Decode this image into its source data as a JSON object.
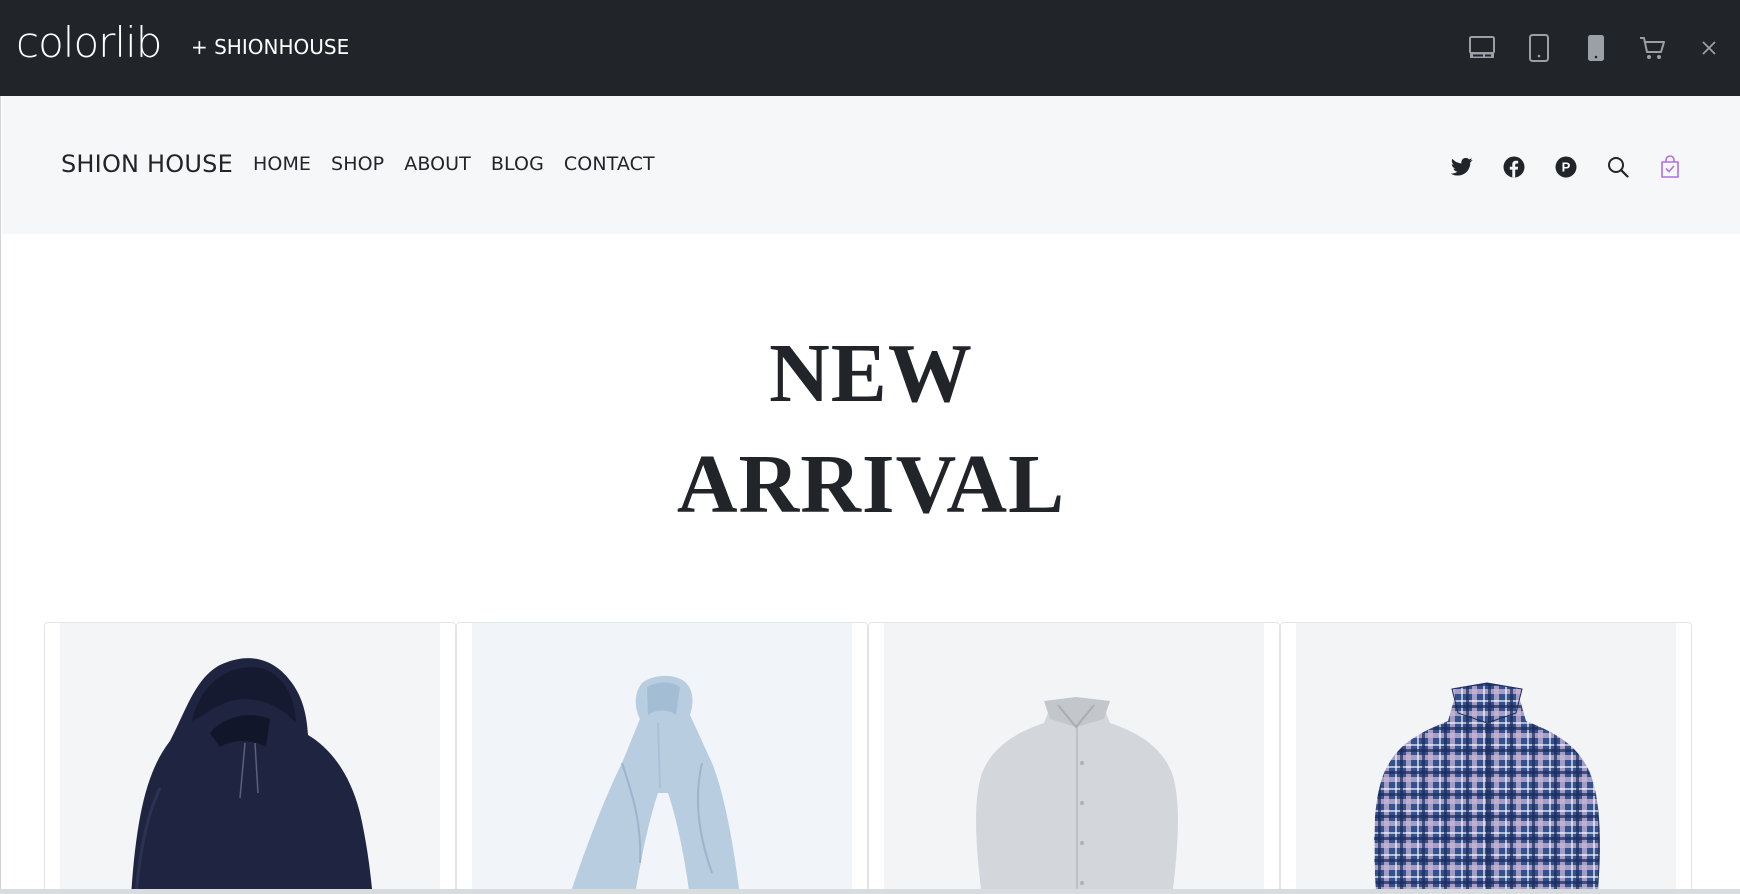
{
  "preview_bar": {
    "brand": "colorlib",
    "product_link": "+ SHIONHOUSE",
    "buttons": [
      {
        "icon": "desktop-icon"
      },
      {
        "icon": "tablet-icon"
      },
      {
        "icon": "mobile-icon"
      },
      {
        "icon": "cart-icon"
      },
      {
        "icon": "close-icon"
      }
    ]
  },
  "site": {
    "logo": "SHION HOUSE",
    "nav": [
      {
        "label": "HOME"
      },
      {
        "label": "SHOP"
      },
      {
        "label": "ABOUT"
      },
      {
        "label": "BLOG"
      },
      {
        "label": "CONTACT"
      }
    ],
    "icons": [
      "twitter-icon",
      "facebook-icon",
      "pinterest-icon",
      "search-icon",
      "shopping-bag-icon"
    ],
    "accent_color": "#b36ee0",
    "heading_line1": "NEW",
    "heading_line2": "ARRIVAL",
    "products": [
      {
        "image": "navy hoodie"
      },
      {
        "image": "light blue scarf"
      },
      {
        "image": "light grey shirt"
      },
      {
        "image": "blue plaid shirt"
      }
    ]
  }
}
